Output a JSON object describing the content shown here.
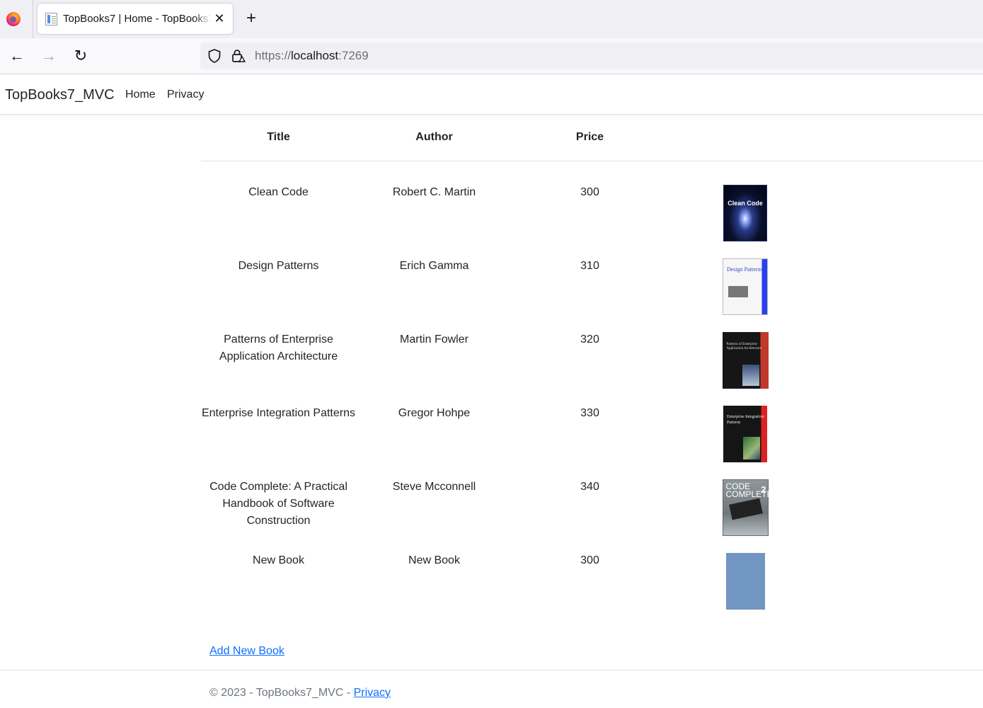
{
  "browser": {
    "tab_title": "TopBooks7 | Home - TopBooks7_MVC",
    "url_scheme": "https://",
    "url_host": "localhost",
    "url_port": ":7269"
  },
  "site": {
    "brand": "TopBooks7_MVC",
    "nav": [
      {
        "label": "Home"
      },
      {
        "label": "Privacy"
      }
    ]
  },
  "table": {
    "headers": {
      "title": "Title",
      "author": "Author",
      "price": "Price"
    },
    "rows": [
      {
        "title": "Clean Code",
        "author": "Robert C. Martin",
        "price": "300",
        "cover_icon": "clean-code-cover",
        "cover_text": "Clean Code"
      },
      {
        "title": "Design Patterns",
        "author": "Erich Gamma",
        "price": "310",
        "cover_icon": "design-patterns-cover",
        "cover_text": "Design Patterns"
      },
      {
        "title": "Patterns of Enterprise Application Architecture",
        "author": "Martin Fowler",
        "price": "320",
        "cover_icon": "patterns-of-enterprise-cover",
        "cover_text": "Patterns of Enterprise Application Architecture"
      },
      {
        "title": "Enterprise Integration Patterns",
        "author": "Gregor Hohpe",
        "price": "330",
        "cover_icon": "enterprise-integration-cover",
        "cover_text": "Enterprise Integration Patterns"
      },
      {
        "title": "Code Complete: A Practical Handbook of Software Construction",
        "author": "Steve Mcconnell",
        "price": "340",
        "cover_icon": "code-complete-cover",
        "cover_text": "CODE COMPLETE",
        "cover_number": "2"
      },
      {
        "title": "New Book",
        "author": "New Book",
        "price": "300",
        "cover_icon": "placeholder-cover",
        "cover_color": "#7196c1"
      }
    ]
  },
  "actions": {
    "add_new_book": "Add New Book"
  },
  "footer": {
    "text": "© 2023 - TopBooks7_MVC - ",
    "privacy_link": "Privacy"
  },
  "colors": {
    "link": "#0d6efd",
    "footer_text": "#6c757d",
    "border": "#dee2e6"
  }
}
